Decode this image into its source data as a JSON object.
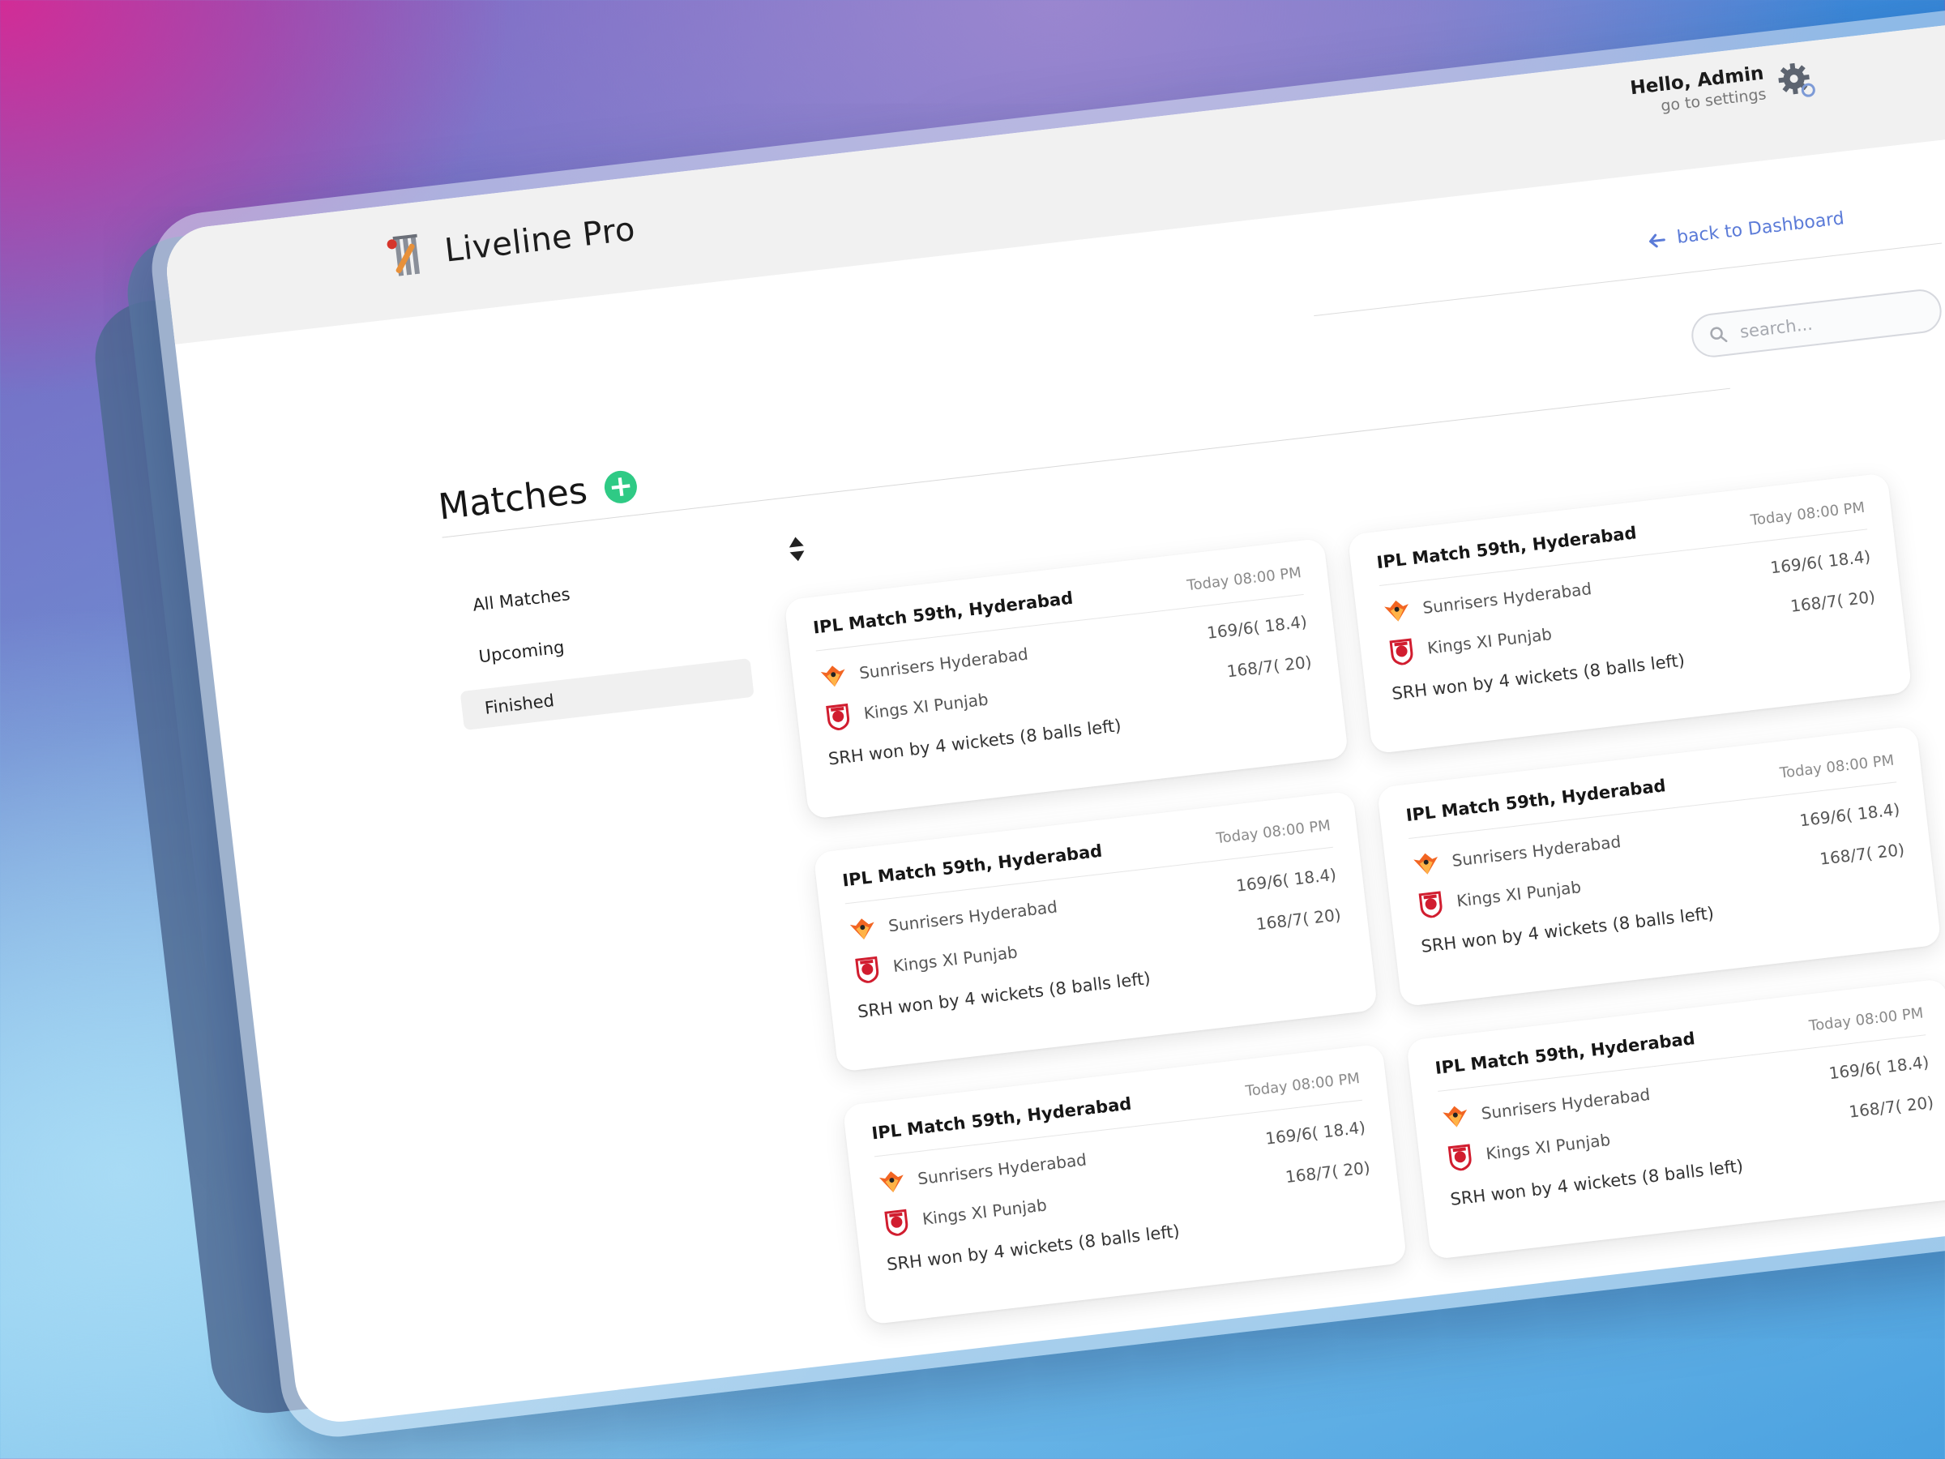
{
  "brand": {
    "title": "Liveline Pro"
  },
  "user": {
    "greeting": "Hello, Admin",
    "settings_link": "go to settings"
  },
  "nav": {
    "back_label": "back to Dashboard"
  },
  "page": {
    "title": "Matches"
  },
  "search": {
    "placeholder": "search..."
  },
  "sidebar": {
    "items": [
      {
        "label": "All Matches",
        "active": false
      },
      {
        "label": "Upcoming",
        "active": false
      },
      {
        "label": "Finished",
        "active": true
      }
    ]
  },
  "matches": [
    {
      "title": "IPL Match 59th, Hyderabad",
      "time": "Today 08:00 PM",
      "team1": {
        "name": "Sunrisers Hyderabad",
        "score": "169/6( 18.4)"
      },
      "team2": {
        "name": "Kings XI Punjab",
        "score": "168/7( 20)"
      },
      "result": "SRH won by 4 wickets (8 balls left)"
    },
    {
      "title": "IPL Match 59th, Hyderabad",
      "time": "Today 08:00 PM",
      "team1": {
        "name": "Sunrisers Hyderabad",
        "score": "169/6( 18.4)"
      },
      "team2": {
        "name": "Kings XI Punjab",
        "score": "168/7( 20)"
      },
      "result": "SRH won by 4 wickets (8 balls left)"
    },
    {
      "title": "IPL Match 59th, Hyderabad",
      "time": "Today 08:00 PM",
      "team1": {
        "name": "Sunrisers Hyderabad",
        "score": "169/6( 18.4)"
      },
      "team2": {
        "name": "Kings XI Punjab",
        "score": "168/7( 20)"
      },
      "result": "SRH won by 4 wickets (8 balls left)"
    },
    {
      "title": "IPL Match 59th, Hyderabad",
      "time": "Today 08:00 PM",
      "team1": {
        "name": "Sunrisers Hyderabad",
        "score": "169/6( 18.4)"
      },
      "team2": {
        "name": "Kings XI Punjab",
        "score": "168/7( 20)"
      },
      "result": "SRH won by 4 wickets (8 balls left)"
    },
    {
      "title": "IPL Match 59th, Hyderabad",
      "time": "Today 08:00 PM",
      "team1": {
        "name": "Sunrisers Hyderabad",
        "score": "169/6( 18.4)"
      },
      "team2": {
        "name": "Kings XI Punjab",
        "score": "168/7( 20)"
      },
      "result": "SRH won by 4 wickets (8 balls left)"
    },
    {
      "title": "IPL Match 59th, Hyderabad",
      "time": "Today 08:00 PM",
      "team1": {
        "name": "Sunrisers Hyderabad",
        "score": "169/6( 18.4)"
      },
      "team2": {
        "name": "Kings XI Punjab",
        "score": "168/7( 20)"
      },
      "result": "SRH won by 4 wickets (8 balls left)"
    }
  ],
  "colors": {
    "accent_green": "#2fca85",
    "link_blue": "#5b7bd8",
    "srh_orange": "#f26522",
    "kxip_red": "#d11d2f"
  },
  "icons": {
    "brand": "cricket-stumps-icon",
    "settings": "gear-icon",
    "back": "arrow-left-icon",
    "search": "search-icon",
    "sort": "sort-icon",
    "add": "plus-icon"
  }
}
